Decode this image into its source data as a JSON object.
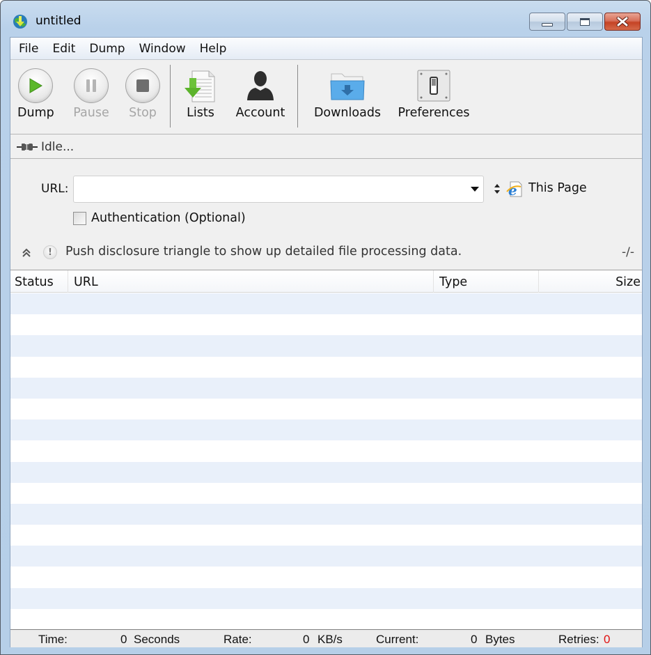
{
  "window": {
    "title": "untitled",
    "app_icon": "globe-download-icon",
    "controls": [
      {
        "name": "minimize",
        "icon": "minimize-icon"
      },
      {
        "name": "maximize",
        "icon": "maximize-icon"
      },
      {
        "name": "close",
        "icon": "close-icon"
      }
    ]
  },
  "menubar": {
    "items": [
      "File",
      "Edit",
      "Dump",
      "Window",
      "Help"
    ]
  },
  "toolbar": {
    "buttons": [
      {
        "label": "Dump",
        "icon": "play-icon",
        "enabled": true
      },
      {
        "label": "Pause",
        "icon": "pause-icon",
        "enabled": false
      },
      {
        "label": "Stop",
        "icon": "stop-icon",
        "enabled": false
      },
      {
        "label": "Lists",
        "icon": "list-download-icon",
        "enabled": true
      },
      {
        "label": "Account",
        "icon": "user-silhouette-icon",
        "enabled": true
      },
      {
        "label": "Downloads",
        "icon": "downloads-folder-icon",
        "enabled": true
      },
      {
        "label": "Preferences",
        "icon": "switch-panel-icon",
        "enabled": true
      }
    ]
  },
  "status": {
    "icon": "plug-icon",
    "text": "Idle..."
  },
  "form": {
    "url_label": "URL:",
    "url_value": "",
    "url_placeholder": "",
    "source_label": "This Page",
    "auth_label": "Authentication (Optional)",
    "auth_checked": false
  },
  "info": {
    "message": "Push disclosure triangle to show up detailed file processing data.",
    "counter": "-/-"
  },
  "table": {
    "columns": [
      "Status",
      "URL",
      "Type",
      "Size"
    ],
    "rows": []
  },
  "footer": {
    "time_label": "Time:",
    "time_value": "0",
    "time_unit": "Seconds",
    "rate_label": "Rate:",
    "rate_value": "0",
    "rate_unit": "KB/s",
    "current_label": "Current:",
    "current_value": "0",
    "current_unit": "Bytes",
    "retries_label": "Retries:",
    "retries_value": "0"
  },
  "colors": {
    "retries_value": "#e01010",
    "row_stripe": "#e9f0fa",
    "dump_green": "#5cb82a"
  }
}
